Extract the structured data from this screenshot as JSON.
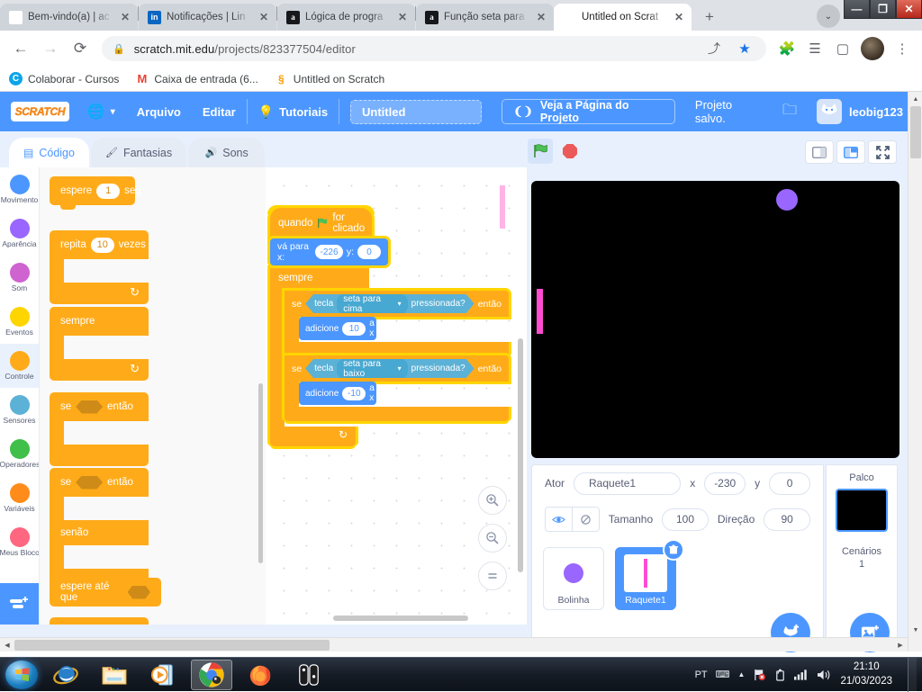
{
  "browser": {
    "tabs": [
      {
        "favicon": "wix-icon",
        "fav_text": "WIX",
        "title": "Bem-vindo(a) | ac",
        "active": false
      },
      {
        "favicon": "linkedin-icon",
        "fav_text": "in",
        "title": "Notificações | Lin",
        "active": false
      },
      {
        "favicon": "alura-icon",
        "fav_text": "a",
        "title": "Lógica de progra",
        "active": false
      },
      {
        "favicon": "alura-icon",
        "fav_text": "a",
        "title": "Função seta para",
        "active": false
      },
      {
        "favicon": "scratch-icon",
        "fav_text": "S",
        "title": "Untitled on Scrat",
        "active": true
      }
    ],
    "new_tab_label": "+",
    "tab_list_label": "⌄",
    "window_controls": {
      "minimize": "—",
      "maximize": "❐",
      "close": "✕"
    },
    "nav": {
      "back": "←",
      "forward": "→",
      "reload": "⟳"
    },
    "omnibox": {
      "lock_icon": "lock-icon",
      "url_domain": "scratch.mit.edu",
      "url_path": "/projects/823377504/editor",
      "share_icon": "share-icon",
      "star_icon": "star-icon"
    },
    "toolbar_icons": {
      "extensions": "puzzle-icon",
      "reading_list": "list-icon",
      "sidepanel": "square-icon",
      "menu": "kebab-menu-icon"
    },
    "bookmarks": [
      {
        "icon": "colaborar-icon",
        "icon_text": "C",
        "label": "Colaborar - Cursos"
      },
      {
        "icon": "gmail-icon",
        "icon_text": "M",
        "label": "Caixa de entrada (6..."
      },
      {
        "icon": "scratch-icon",
        "icon_text": "S",
        "label": "Untitled on Scratch"
      }
    ]
  },
  "scratch": {
    "menubar": {
      "logo_text": "SCRATCH",
      "globe_icon": "globe-icon",
      "globe_caret": "▾",
      "file_label": "Arquivo",
      "edit_label": "Editar",
      "tutorials_icon": "lightbulb-icon",
      "tutorials_label": "Tutoriais",
      "project_title": "Untitled",
      "see_project_icon": "share-arrows-icon",
      "see_project_label": "Veja a Página do Projeto",
      "saved_status": "Projeto salvo.",
      "folder_icon": "folder-icon",
      "account_avatar": "cat-avatar",
      "account_name": "leobig123",
      "account_caret": "▾"
    },
    "tabs": [
      {
        "icon": "code-icon",
        "label": "Código",
        "active": true
      },
      {
        "icon": "paintbrush-icon",
        "label": "Fantasias",
        "active": false
      },
      {
        "icon": "speaker-icon",
        "label": "Sons",
        "active": false
      }
    ],
    "stage_controls": {
      "green_flag_icon": "green-flag-icon",
      "stop_icon": "stop-sign-icon",
      "layout_small_icon": "small-stage-icon",
      "layout_large_icon": "large-stage-icon",
      "layout_full_icon": "fullscreen-icon"
    },
    "categories": [
      {
        "label": "Movimento",
        "color": "#4c97ff",
        "selected": false
      },
      {
        "label": "Aparência",
        "color": "#9966ff",
        "selected": false
      },
      {
        "label": "Som",
        "color": "#cf63cf",
        "selected": false
      },
      {
        "label": "Eventos",
        "color": "#ffd500",
        "selected": false
      },
      {
        "label": "Controle",
        "color": "#ffab19",
        "selected": true
      },
      {
        "label": "Sensores",
        "color": "#5cb1d6",
        "selected": false
      },
      {
        "label": "Operadores",
        "color": "#40bf4a",
        "selected": false
      },
      {
        "label": "Variáveis",
        "color": "#ff8c1a",
        "selected": false
      },
      {
        "label": "Meus Blocos",
        "color": "#ff6680",
        "selected": false
      }
    ],
    "add_extension_icon": "add-extension-icon",
    "palette_blocks": [
      {
        "type": "stack",
        "words": [
          "espere"
        ],
        "input": "1",
        "tail": "seg"
      },
      {
        "type": "loop",
        "words": [
          "repita"
        ],
        "input": "10",
        "tail": "vezes",
        "loop_icon": "loop-arrow-icon"
      },
      {
        "type": "loop",
        "words": [
          "sempre"
        ],
        "loop_icon": "loop-arrow-icon"
      },
      {
        "type": "ifthen",
        "words": [
          "se"
        ],
        "tail": "então"
      },
      {
        "type": "ifelse",
        "words": [
          "se"
        ],
        "tail": "então",
        "else_label": "senão"
      },
      {
        "type": "stack-bool",
        "words": [
          "espere até que"
        ]
      }
    ],
    "script": {
      "hat": {
        "pre": "quando",
        "flag_icon": "green-flag-icon",
        "post": "for clicado"
      },
      "goto": {
        "label_x": "vá para x:",
        "x": "-226",
        "label_y": "y:",
        "y": "0"
      },
      "forever": {
        "label": "sempre",
        "loop_icon": "loop-arrow-icon"
      },
      "if_blocks": [
        {
          "se": "se",
          "key_word": "tecla",
          "key_value": "seta para cima",
          "dropdown_caret": "▾",
          "pressed": "pressionada?",
          "entao": "então",
          "body_pre": "adicione",
          "body_value": "10",
          "body_post": "a x"
        },
        {
          "se": "se",
          "key_word": "tecla",
          "key_value": "seta para baixo",
          "dropdown_caret": "▾",
          "pressed": "pressionada?",
          "entao": "então",
          "body_pre": "adicione",
          "body_value": "-10",
          "body_post": "a x"
        }
      ]
    },
    "zoom_controls": {
      "zoom_in": "zoom-in-icon",
      "zoom_out": "zoom-out-icon",
      "zoom_reset": "zoom-reset-icon"
    },
    "sprite_info": {
      "sprite_label": "Ator",
      "sprite_name": "Raquete1",
      "x_label": "x",
      "x_value": "-230",
      "y_label": "y",
      "y_value": "0",
      "show_icon": "eye-icon",
      "hide_icon": "eye-slash-icon",
      "size_label": "Tamanho",
      "size_value": "100",
      "direction_label": "Direção",
      "direction_value": "90"
    },
    "sprites": [
      {
        "name": "Bolinha",
        "thumb": "purple-ball",
        "selected": false
      },
      {
        "name": "Raquete1",
        "thumb": "pink-paddle",
        "selected": true,
        "delete_icon": "trash-icon"
      }
    ],
    "add_sprite_icon": "add-sprite-cat-icon",
    "add_backdrop_icon": "add-backdrop-icon",
    "stage_panel": {
      "title": "Palco",
      "backdrops_label": "Cenários",
      "backdrops_count": "1"
    },
    "stage_objects": {
      "ball_color": "#9966ff",
      "paddle_color": "#ff4dd2",
      "background_color": "#000000"
    }
  },
  "taskbar": {
    "start_icon": "windows-start-icon",
    "apps": [
      {
        "name": "internet-explorer",
        "active": false
      },
      {
        "name": "file-explorer",
        "active": false
      },
      {
        "name": "media-player",
        "active": false
      },
      {
        "name": "google-chrome",
        "active": true
      },
      {
        "name": "firefox",
        "active": false
      },
      {
        "name": "nintendo-switch",
        "active": false
      }
    ],
    "tray": {
      "language": "PT",
      "keyboard_icon": "keyboard-icon",
      "expand_icon": "▲",
      "network_icon": "network-error-icon",
      "battery_icon": "battery-icon",
      "signal_icon": "signal-icon",
      "volume_icon": "volume-icon"
    },
    "clock_time": "21:10",
    "clock_date": "21/03/2023"
  }
}
